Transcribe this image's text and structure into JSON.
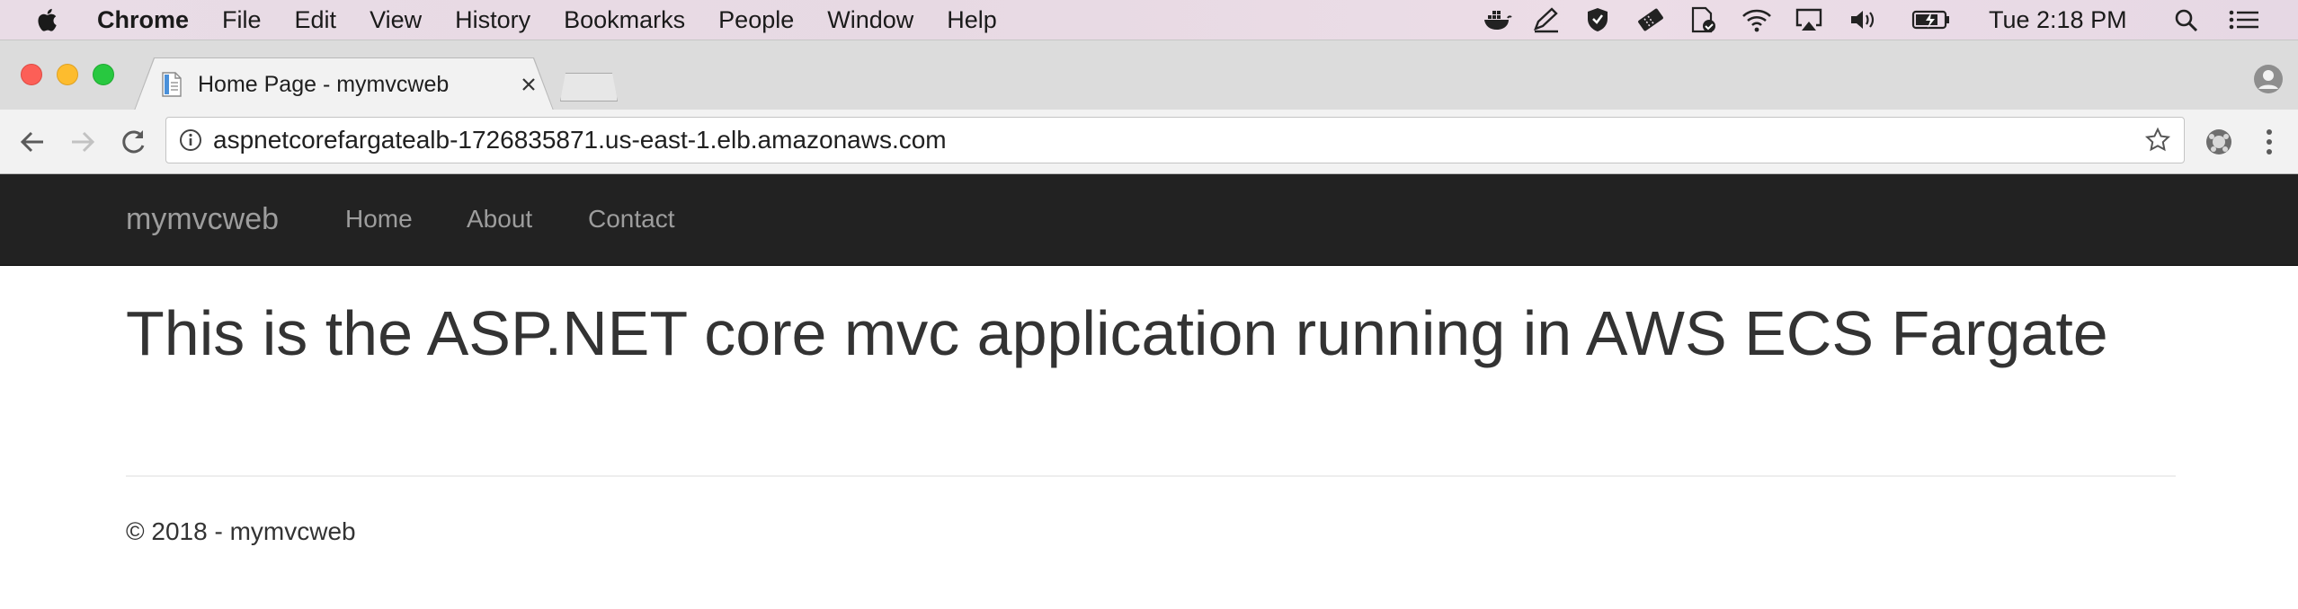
{
  "menubar": {
    "app_name": "Chrome",
    "menus": [
      "File",
      "Edit",
      "View",
      "History",
      "Bookmarks",
      "People",
      "Window",
      "Help"
    ],
    "clock": "Tue 2:18 PM",
    "status_icons": [
      "docker-icon",
      "pen-icon",
      "shield-icon",
      "ticket-icon",
      "document-check-icon",
      "wifi-icon",
      "airplay-icon",
      "volume-icon",
      "battery-icon",
      "spotlight-icon",
      "notification-center-icon"
    ]
  },
  "browser": {
    "tab_title": "Home Page - mymvcweb",
    "url": "aspnetcorefargatealb-1726835871.us-east-1.elb.amazonaws.com"
  },
  "site": {
    "brand": "mymvcweb",
    "nav": [
      "Home",
      "About",
      "Contact"
    ],
    "heading": "This is the ASP.NET core mvc application running in AWS ECS Fargate",
    "footer": "© 2018 - mymvcweb"
  },
  "colors": {
    "navbar_bg": "#222222",
    "navbar_text": "#9d9d9d",
    "heading_text": "#333333"
  }
}
